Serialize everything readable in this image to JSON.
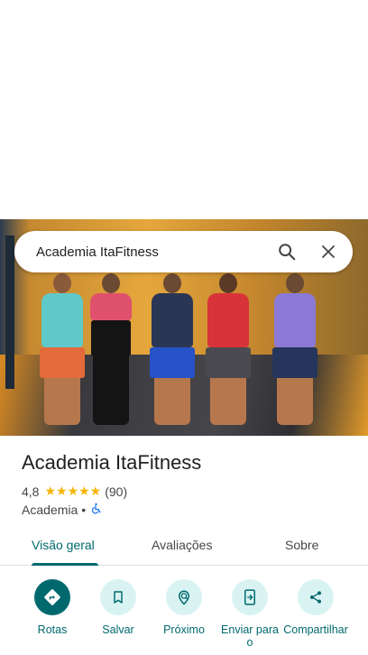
{
  "search": {
    "query": "Academia ItaFitness"
  },
  "place": {
    "name": "Academia ItaFitness",
    "rating": "4,8",
    "stars": "★★★★★",
    "review_count": "(90)",
    "category": "Academia",
    "separator": "•"
  },
  "tabs": [
    {
      "label": "Visão geral",
      "active": true
    },
    {
      "label": "Avaliações",
      "active": false
    },
    {
      "label": "Sobre",
      "active": false
    }
  ],
  "actions": [
    {
      "label": "Rotas",
      "icon": "directions-icon"
    },
    {
      "label": "Salvar",
      "icon": "bookmark-icon"
    },
    {
      "label": "Próximo",
      "icon": "nearby-icon"
    },
    {
      "label": "Enviar para o",
      "icon": "send-to-phone-icon"
    },
    {
      "label": "Compartilhar",
      "icon": "share-icon"
    }
  ],
  "colors": {
    "accent": "#00696e",
    "accent_light": "#d9f3f3",
    "star": "#f6b400"
  }
}
